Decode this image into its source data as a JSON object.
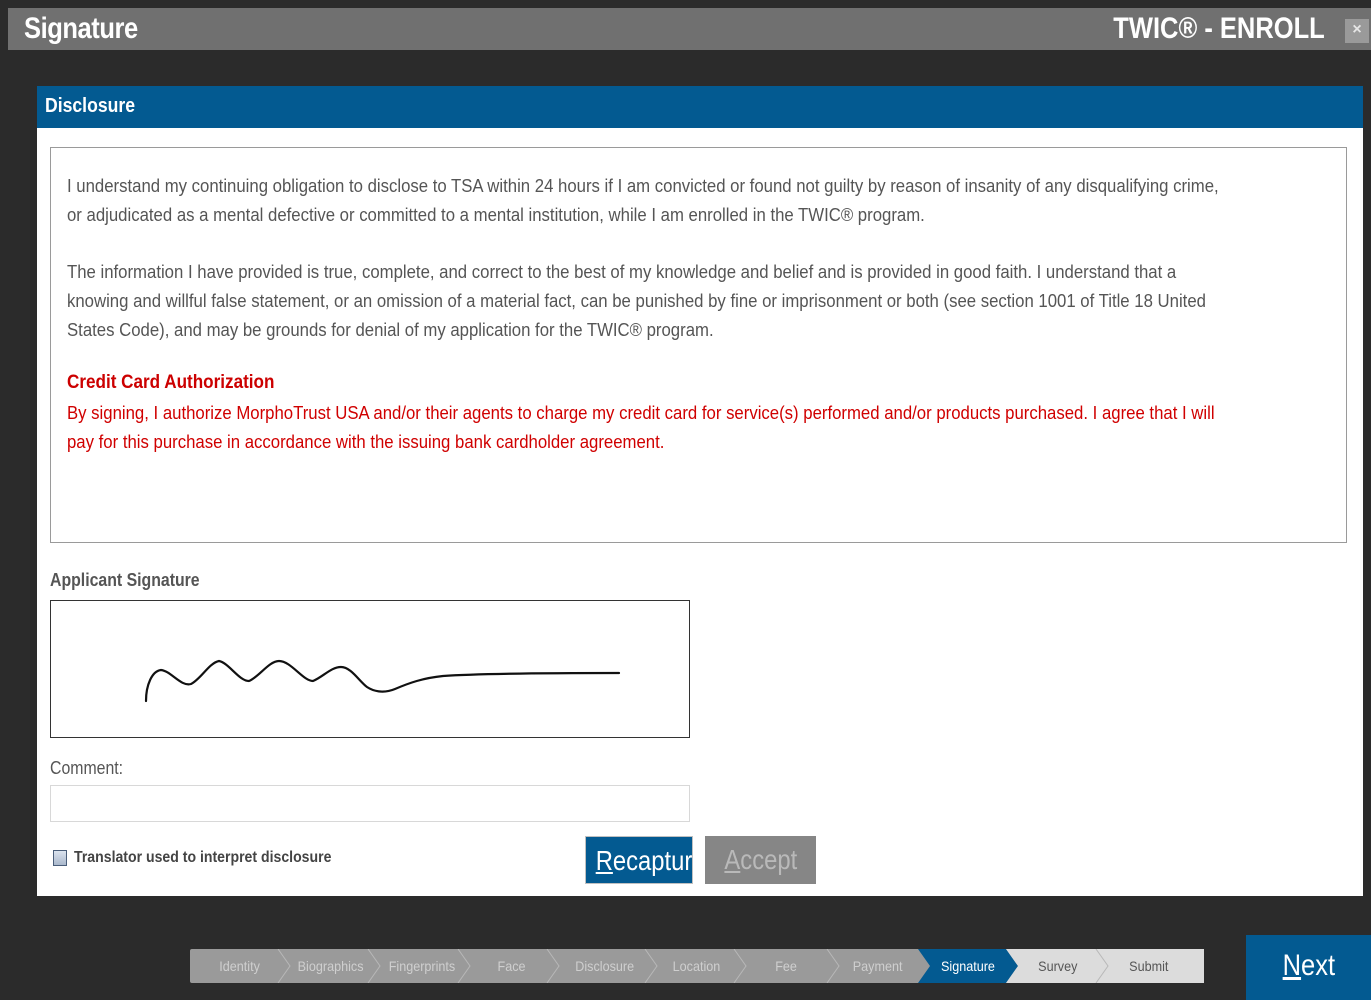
{
  "window": {
    "title": "Signature",
    "app_name": "TWIC® - ENROLL",
    "close_label": "×"
  },
  "panel": {
    "header": "Disclosure"
  },
  "disclosure": {
    "para1_lines": [
      "I understand my continuing obligation to disclose to TSA within 24 hours if I am convicted or found not guilty by reason of insanity of any disqualifying crime,",
      "or adjudicated as a mental defective or committed to a mental institution, while I am enrolled in the TWIC® program."
    ],
    "para2_lines": [
      "The information I have provided is true, complete, and correct to the best of my knowledge and belief and is provided in good faith. I understand that a",
      "knowing and willful false statement, or an omission of a material fact, can be punished by fine or imprisonment or both (see section 1001 of Title 18 United",
      "States Code), and may be grounds for denial of my application for the TWIC® program."
    ],
    "cc_title": "Credit Card Authorization",
    "cc_lines": [
      "By signing, I authorize MorphoTrust USA and/or their agents to charge my credit card for service(s) performed and/or products purchased. I agree that I will",
      "pay for this purchase in accordance with the issuing bank cardholder agreement."
    ]
  },
  "signature": {
    "label": "Applicant Signature"
  },
  "comment": {
    "label": "Comment:",
    "value": ""
  },
  "translator": {
    "label": "Translator used to interpret disclosure",
    "checked": false
  },
  "buttons": {
    "recapture_first": "R",
    "recapture_rest": "ecapture",
    "accept_first": "A",
    "accept_rest": "ccept"
  },
  "steps": [
    {
      "label": "Identity",
      "state": "done"
    },
    {
      "label": "Biographics",
      "state": "done"
    },
    {
      "label": "Fingerprints",
      "state": "done"
    },
    {
      "label": "Face",
      "state": "done"
    },
    {
      "label": "Disclosure",
      "state": "done"
    },
    {
      "label": "Location",
      "state": "done"
    },
    {
      "label": "Fee",
      "state": "done"
    },
    {
      "label": "Payment",
      "state": "done"
    },
    {
      "label": "Signature",
      "state": "current"
    },
    {
      "label": "Survey",
      "state": "pending"
    },
    {
      "label": "Submit",
      "state": "pending"
    }
  ],
  "next": {
    "first": "N",
    "rest": "ext"
  },
  "colors": {
    "accent_blue": "#035a91",
    "step_done_bg": "#9a9a9a",
    "step_pending_bg": "#dcdcdc",
    "credit_red": "#d00000"
  }
}
